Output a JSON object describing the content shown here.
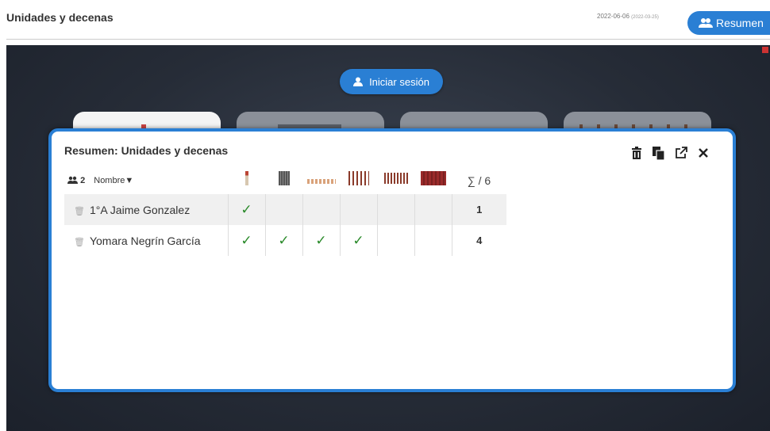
{
  "header": {
    "title": "Unidades y decenas",
    "date": "2022-06-06",
    "date_sub": "(2022-03-25)",
    "resumen_label": "Resumen"
  },
  "stage": {
    "login_label": "Iniciar sesión"
  },
  "modal": {
    "title": "Resumen: Unidades y decenas",
    "student_count": "2",
    "name_header": "Nombre▼",
    "sum_header": "∑ / 6",
    "activities": [
      "activity-1",
      "activity-2",
      "activity-3",
      "activity-4",
      "activity-5",
      "activity-6"
    ],
    "rows": [
      {
        "name": "1°A Jaime Gonzalez",
        "marks": [
          "✓",
          "",
          "",
          "",
          "",
          ""
        ],
        "total": "1"
      },
      {
        "name": "Yomara Negrín García",
        "marks": [
          "✓",
          "✓",
          "✓",
          "✓",
          "",
          ""
        ],
        "total": "4"
      }
    ]
  },
  "colors": {
    "accent": "#2a7fd4",
    "check": "#2a8a2a"
  }
}
